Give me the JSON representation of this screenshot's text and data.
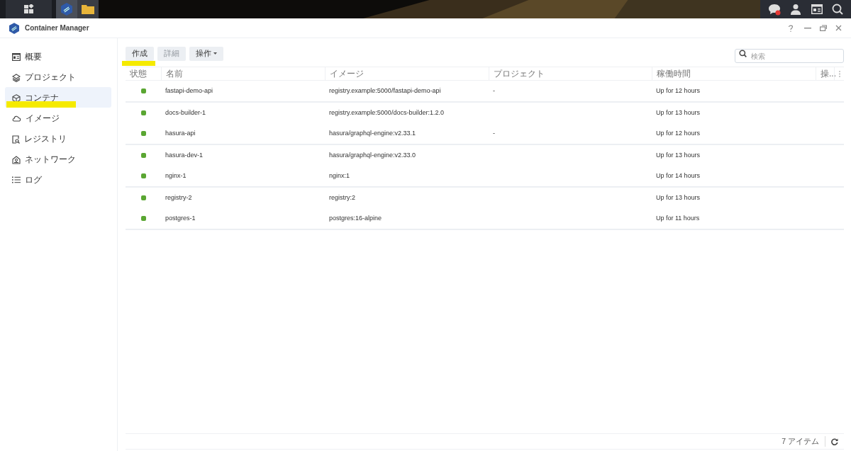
{
  "window": {
    "title": "Container Manager"
  },
  "sidebar": {
    "items": [
      {
        "label": "概要",
        "selected": false
      },
      {
        "label": "プロジェクト",
        "selected": false
      },
      {
        "label": "コンテナ",
        "selected": true
      },
      {
        "label": "イメージ",
        "selected": false
      },
      {
        "label": "レジストリ",
        "selected": false
      },
      {
        "label": "ネットワーク",
        "selected": false
      },
      {
        "label": "ログ",
        "selected": false
      }
    ]
  },
  "toolbar": {
    "buttons": [
      {
        "label": "作成",
        "disabled": false,
        "dropdown": false
      },
      {
        "label": "詳細",
        "disabled": true,
        "dropdown": false
      },
      {
        "label": "操作",
        "disabled": false,
        "dropdown": true
      }
    ],
    "search": {
      "placeholder": "検索"
    }
  },
  "table": {
    "columns": [
      "状態",
      "名前",
      "イメージ",
      "プロジェクト",
      "稼働時間",
      "操..."
    ],
    "row_groups": [
      [
        {
          "running": true,
          "name": "fastapi-demo-api",
          "image": "registry.example:5000/fastapi-demo-api",
          "project": "-",
          "uptime": "Up for 12 hours"
        }
      ],
      [
        {
          "running": true,
          "name": "docs-builder-1",
          "image": "registry.example:5000/docs-builder:1.2.0",
          "uptime": "Up for 13 hours"
        },
        {
          "running": true,
          "name": "hasura-api",
          "image": "hasura/graphql-engine:v2.33.1",
          "project": "-",
          "uptime": "Up for 12 hours"
        }
      ],
      [
        {
          "running": true,
          "name": "hasura-dev-1",
          "image": "hasura/graphql-engine:v2.33.0",
          "uptime": "Up for 13 hours"
        },
        {
          "running": true,
          "name": "nginx-1",
          "image": "nginx:1",
          "uptime": "Up for 14 hours"
        }
      ],
      [
        {
          "running": true,
          "name": "registry-2",
          "image": "registry:2",
          "uptime": "Up for 13 hours"
        },
        {
          "running": true,
          "name": "postgres-1",
          "image": "postgres:16-alpine",
          "uptime": "Up for 11 hours"
        }
      ]
    ]
  },
  "footer": {
    "count": "7 アイテム"
  }
}
